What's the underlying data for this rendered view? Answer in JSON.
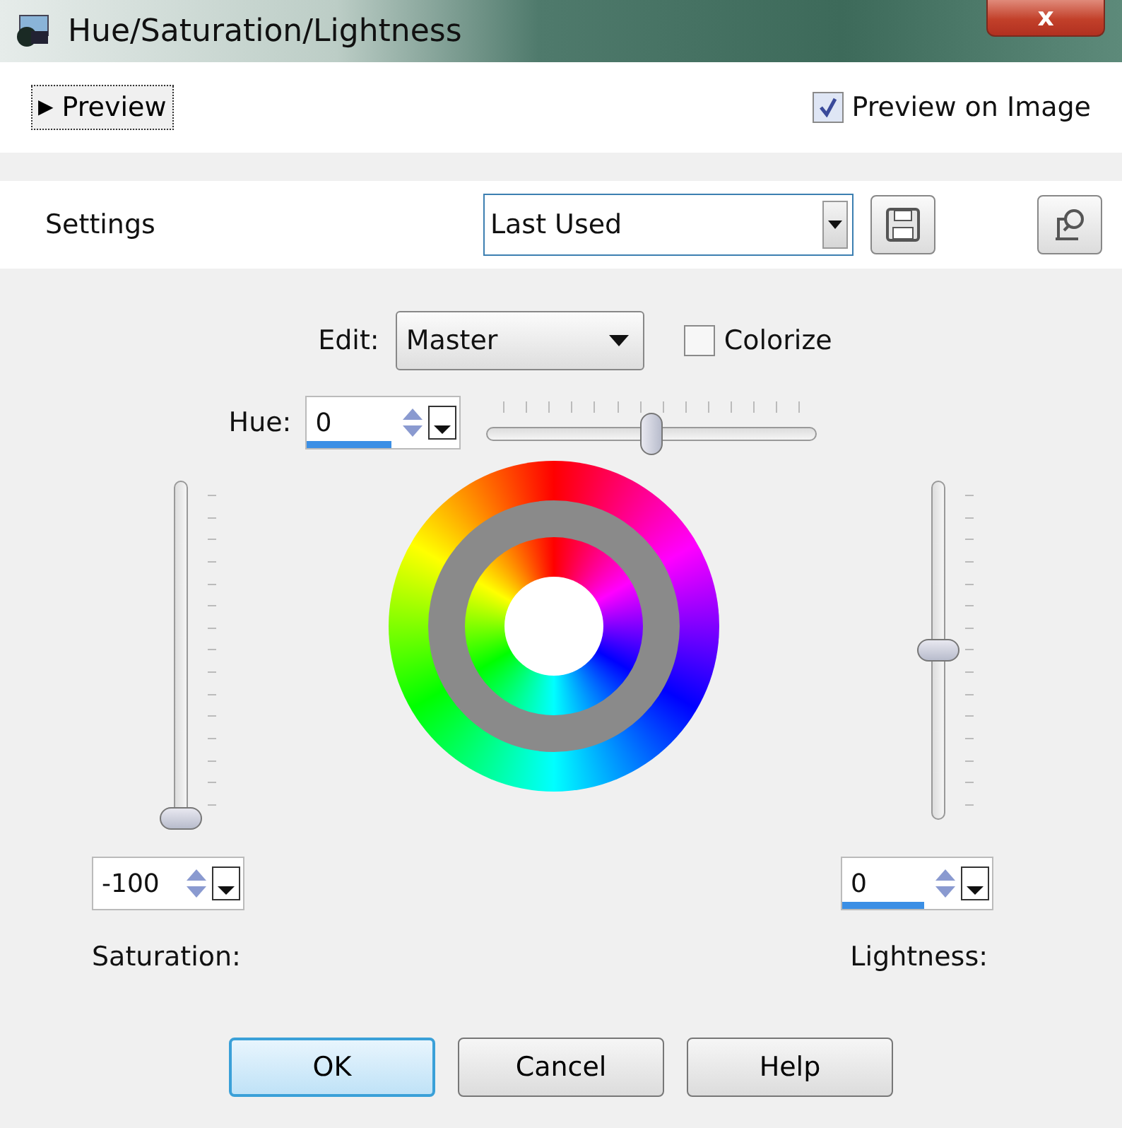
{
  "window": {
    "title": "Hue/Saturation/Lightness",
    "close": "x"
  },
  "preview": {
    "toggle": "▶",
    "label": "Preview",
    "expanded": false
  },
  "preview_on_image": {
    "label": "Preview on Image",
    "checked": true
  },
  "settings": {
    "label": "Settings",
    "value": "Last Used"
  },
  "edit": {
    "label": "Edit:",
    "value": "Master"
  },
  "colorize": {
    "label": "Colorize",
    "checked": false
  },
  "hue": {
    "label": "Hue:",
    "field": {
      "value": "0",
      "level": 0.55
    },
    "slider": {
      "level": 0.5
    }
  },
  "saturation": {
    "label": "Saturation:",
    "field": {
      "value": "-100"
    },
    "slider": {
      "level": 0
    }
  },
  "lightness": {
    "label": "Lightness:",
    "field": {
      "value": "0",
      "level": 0.55
    },
    "slider": {
      "level": 0.5
    }
  },
  "buttons": [
    {
      "label": "OK",
      "default": true
    },
    {
      "label": "Cancel",
      "default": false
    },
    {
      "label": "Help",
      "default": false
    }
  ]
}
